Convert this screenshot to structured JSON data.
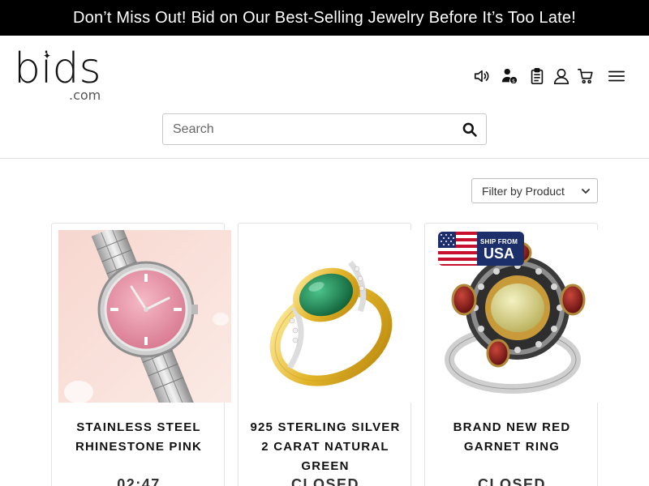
{
  "promo": {
    "text": "Don’t Miss Out! Bid on Our Best-Selling Jewelry Before It’s Too Late!"
  },
  "logo": {
    "word": "bids",
    "domain": ".com"
  },
  "header": {
    "icons": [
      "speaker-icon",
      "user-dollar-icon",
      "clipboard-icon",
      "account-icon",
      "cart-icon",
      "menu-icon"
    ]
  },
  "search": {
    "placeholder": "Search",
    "value": ""
  },
  "filter": {
    "selected": "Filter by Product"
  },
  "products": [
    {
      "title": "STAINLESS STEEL RHINESTONE PINK",
      "status": "02:47"
    },
    {
      "title": "925 STERLING SILVER 2 CARAT NATURAL GREEN",
      "status": "CLOSED"
    },
    {
      "title": "BRAND NEW RED GARNET RING",
      "status": "CLOSED",
      "badge_small": "SHIP FROM",
      "badge_big": "USA"
    }
  ],
  "colors": {
    "promo_bg": "#000000",
    "badge_bg": "#1c2f6b",
    "text": "#111111"
  }
}
